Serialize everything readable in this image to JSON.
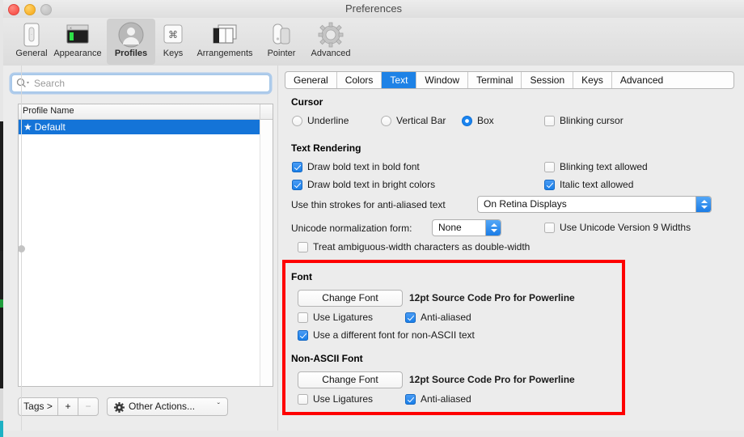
{
  "window": {
    "title": "Preferences",
    "traffic_lights": [
      "close",
      "minimize",
      "zoom"
    ]
  },
  "toolbar": {
    "items": [
      {
        "label": "General",
        "icon": "general-icon",
        "selected": false
      },
      {
        "label": "Appearance",
        "icon": "appearance-icon",
        "selected": false
      },
      {
        "label": "Profiles",
        "icon": "profiles-icon",
        "selected": true
      },
      {
        "label": "Keys",
        "icon": "keys-icon",
        "selected": false
      },
      {
        "label": "Arrangements",
        "icon": "arrangements-icon",
        "selected": false
      },
      {
        "label": "Pointer",
        "icon": "pointer-icon",
        "selected": false
      },
      {
        "label": "Advanced",
        "icon": "advanced-gear-icon",
        "selected": false
      }
    ]
  },
  "sidebar": {
    "search": {
      "placeholder": "Search",
      "value": "",
      "icon": "search-icon"
    },
    "table": {
      "column_header": "Profile Name",
      "rows": [
        {
          "star": "★",
          "name": "Default",
          "selected": true
        }
      ]
    },
    "buttons": {
      "tags": "Tags >",
      "add": "+",
      "remove": "−",
      "other_actions": "Other Actions...",
      "other_actions_icon": "gear-icon",
      "other_actions_chevron": "ˇ"
    }
  },
  "tabs": [
    {
      "label": "General",
      "active": false
    },
    {
      "label": "Colors",
      "active": false
    },
    {
      "label": "Text",
      "active": true
    },
    {
      "label": "Window",
      "active": false
    },
    {
      "label": "Terminal",
      "active": false
    },
    {
      "label": "Session",
      "active": false
    },
    {
      "label": "Keys",
      "active": false
    },
    {
      "label": "Advanced",
      "active": false
    }
  ],
  "sections": {
    "cursor": {
      "title": "Cursor",
      "radios": [
        {
          "label": "Underline",
          "checked": false
        },
        {
          "label": "Vertical Bar",
          "checked": false
        },
        {
          "label": "Box",
          "checked": true
        }
      ],
      "blinking_cursor": {
        "label": "Blinking cursor",
        "checked": false
      }
    },
    "text_rendering": {
      "title": "Text Rendering",
      "checkboxes": [
        {
          "label": "Draw bold text in bold font",
          "checked": true
        },
        {
          "label": "Draw bold text in bright colors",
          "checked": true
        },
        {
          "label": "Blinking text allowed",
          "checked": false
        },
        {
          "label": "Italic text allowed",
          "checked": true
        }
      ],
      "thin_strokes": {
        "label": "Use thin strokes for anti-aliased text",
        "value": "On Retina Displays"
      },
      "unicode_normalization": {
        "label": "Unicode normalization form:",
        "value": "None"
      },
      "unicode9_widths": {
        "label": "Use Unicode Version 9 Widths",
        "checked": false
      },
      "ambiguous_width": {
        "label": "Treat ambiguous-width characters as double-width",
        "checked": false
      }
    },
    "font": {
      "title": "Font",
      "change_font_button": "Change Font",
      "font_value": "12pt Source Code Pro for Powerline",
      "use_ligatures": {
        "label": "Use Ligatures",
        "checked": false
      },
      "anti_aliased": {
        "label": "Anti-aliased",
        "checked": true
      },
      "different_font_non_ascii": {
        "label": "Use a different font for non-ASCII text",
        "checked": true
      }
    },
    "non_ascii_font": {
      "title": "Non-ASCII Font",
      "change_font_button": "Change Font",
      "font_value": "12pt Source Code Pro for Powerline",
      "use_ligatures": {
        "label": "Use Ligatures",
        "checked": false
      },
      "anti_aliased": {
        "label": "Anti-aliased",
        "checked": true
      }
    }
  },
  "annotation": {
    "highlight_color": "#fe0000"
  }
}
